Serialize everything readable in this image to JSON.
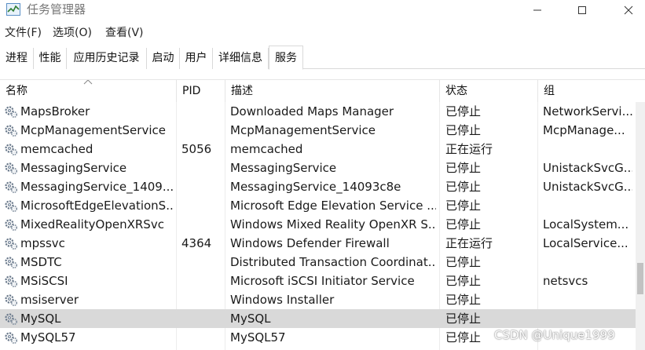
{
  "window": {
    "title": "任务管理器",
    "buttons": {
      "minimize": "minimize",
      "maximize": "maximize",
      "close": "close"
    }
  },
  "menu": [
    "文件(F)",
    "选项(O)",
    "查看(V)"
  ],
  "tabs": [
    "进程",
    "性能",
    "应用历史记录",
    "启动",
    "用户",
    "详细信息",
    "服务"
  ],
  "active_tab": "服务",
  "table": {
    "columns": [
      "名称",
      "PID",
      "描述",
      "状态",
      "组"
    ],
    "sorted_column": "名称",
    "rows": [
      {
        "name": "MapsBroker",
        "pid": "",
        "desc": "Downloaded Maps Manager",
        "status": "已停止",
        "group": "NetworkServi..."
      },
      {
        "name": "McpManagementService",
        "pid": "",
        "desc": "McpManagementService",
        "status": "已停止",
        "group": "McpManage..."
      },
      {
        "name": "memcached",
        "pid": "5056",
        "desc": "memcached",
        "status": "正在运行",
        "group": ""
      },
      {
        "name": "MessagingService",
        "pid": "",
        "desc": "MessagingService",
        "status": "已停止",
        "group": "UnistackSvcG..."
      },
      {
        "name": "MessagingService_1409...",
        "pid": "",
        "desc": "MessagingService_14093c8e",
        "status": "已停止",
        "group": "UnistackSvcG..."
      },
      {
        "name": "MicrosoftEdgeElevationS...",
        "pid": "",
        "desc": "Microsoft Edge Elevation Service ...",
        "status": "已停止",
        "group": ""
      },
      {
        "name": "MixedRealityOpenXRSvc",
        "pid": "",
        "desc": "Windows Mixed Reality OpenXR S...",
        "status": "已停止",
        "group": "LocalSystem..."
      },
      {
        "name": "mpssvc",
        "pid": "4364",
        "desc": "Windows Defender Firewall",
        "status": "正在运行",
        "group": "LocalService..."
      },
      {
        "name": "MSDTC",
        "pid": "",
        "desc": "Distributed Transaction Coordinat...",
        "status": "已停止",
        "group": ""
      },
      {
        "name": "MSiSCSI",
        "pid": "",
        "desc": "Microsoft iSCSI Initiator Service",
        "status": "已停止",
        "group": "netsvcs"
      },
      {
        "name": "msiserver",
        "pid": "",
        "desc": "Windows Installer",
        "status": "已停止",
        "group": ""
      },
      {
        "name": "MySQL",
        "pid": "",
        "desc": "MySQL",
        "status": "已停止",
        "group": "",
        "selected": true
      },
      {
        "name": "MySQL57",
        "pid": "",
        "desc": "MySQL57",
        "status": "已停止",
        "group": ""
      }
    ]
  },
  "watermark": "CSDN @Unique1999",
  "colors": {
    "selected_row": "#d9d9d9",
    "text": "#1a1a1a"
  }
}
